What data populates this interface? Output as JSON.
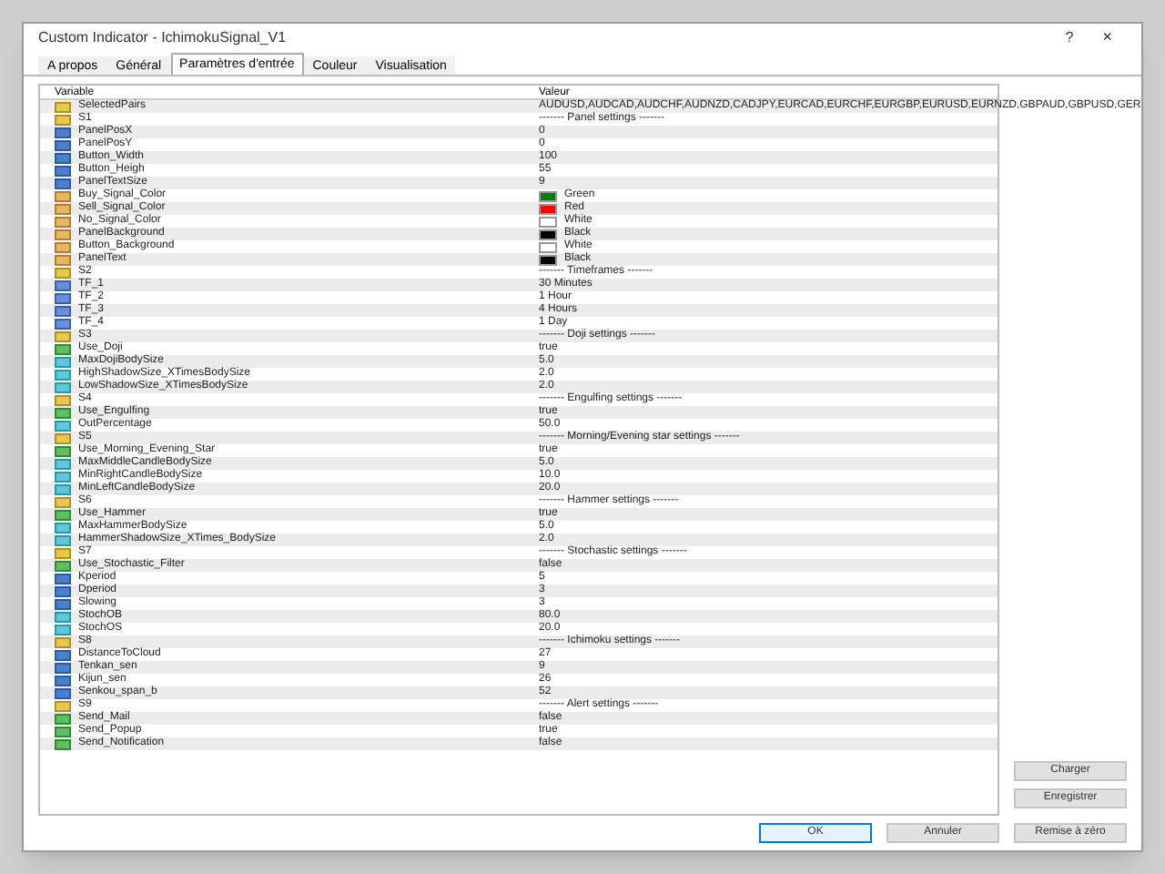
{
  "window": {
    "title": "Custom Indicator - IchimokuSignal_V1",
    "help": "?",
    "close": "×"
  },
  "tabs": [
    {
      "label": "A propos",
      "selected": false
    },
    {
      "label": "Général",
      "selected": false
    },
    {
      "label": "Paramètres d'entrée",
      "selected": true
    },
    {
      "label": "Couleur",
      "selected": false
    },
    {
      "label": "Visualisation",
      "selected": false
    }
  ],
  "table": {
    "columns": [
      "Variable",
      "Valeur"
    ],
    "rows": [
      {
        "name": "SelectedPairs",
        "value": "AUDUSD,AUDCAD,AUDCHF,AUDNZD,CADJPY,EURCAD,EURCHF,EURGBP,EURUSD,EURNZD,GBPAUD,GBPUSD,GER",
        "kind": "string"
      },
      {
        "name": "S1",
        "value": "------- Panel settings -------",
        "kind": "string"
      },
      {
        "name": "PanelPosX",
        "value": "0",
        "kind": "int"
      },
      {
        "name": "PanelPosY",
        "value": "0",
        "kind": "int"
      },
      {
        "name": "Button_Width",
        "value": "100",
        "kind": "int"
      },
      {
        "name": "Button_Heigh",
        "value": "55",
        "kind": "int"
      },
      {
        "name": "PanelTextSize",
        "value": "9",
        "kind": "int"
      },
      {
        "name": "Buy_Signal_Color",
        "value": "Green",
        "kind": "color",
        "color": "#008000"
      },
      {
        "name": "Sell_Signal_Color",
        "value": "Red",
        "kind": "color",
        "color": "#ff0000"
      },
      {
        "name": "No_Signal_Color",
        "value": "White",
        "kind": "color",
        "color": "#ffffff"
      },
      {
        "name": "PanelBackground",
        "value": "Black",
        "kind": "color",
        "color": "#000000"
      },
      {
        "name": "Button_Background",
        "value": "White",
        "kind": "color",
        "color": "#ffffff"
      },
      {
        "name": "PanelText",
        "value": "Black",
        "kind": "color",
        "color": "#000000"
      },
      {
        "name": "S2",
        "value": "------- Timeframes -------",
        "kind": "string"
      },
      {
        "name": "TF_1",
        "value": "30 Minutes",
        "kind": "enum"
      },
      {
        "name": "TF_2",
        "value": "1 Hour",
        "kind": "enum"
      },
      {
        "name": "TF_3",
        "value": "4 Hours",
        "kind": "enum"
      },
      {
        "name": "TF_4",
        "value": "1 Day",
        "kind": "enum"
      },
      {
        "name": "S3",
        "value": "------- Doji settings -------",
        "kind": "string"
      },
      {
        "name": "Use_Doji",
        "value": "true",
        "kind": "bool"
      },
      {
        "name": "MaxDojiBodySize",
        "value": "5.0",
        "kind": "double"
      },
      {
        "name": "HighShadowSize_XTimesBodySize",
        "value": "2.0",
        "kind": "double"
      },
      {
        "name": "LowShadowSize_XTimesBodySize",
        "value": "2.0",
        "kind": "double"
      },
      {
        "name": "S4",
        "value": "------- Engulfing settings -------",
        "kind": "string"
      },
      {
        "name": "Use_Engulfing",
        "value": "true",
        "kind": "bool"
      },
      {
        "name": "OutPercentage",
        "value": "50.0",
        "kind": "double"
      },
      {
        "name": "S5",
        "value": "------- Morning/Evening star settings -------",
        "kind": "string"
      },
      {
        "name": "Use_Morning_Evening_Star",
        "value": "true",
        "kind": "bool"
      },
      {
        "name": "MaxMiddleCandleBodySize",
        "value": "5.0",
        "kind": "double"
      },
      {
        "name": "MinRightCandleBodySize",
        "value": "10.0",
        "kind": "double"
      },
      {
        "name": "MinLeftCandleBodySize",
        "value": "20.0",
        "kind": "double"
      },
      {
        "name": "S6",
        "value": "------- Hammer settings -------",
        "kind": "string"
      },
      {
        "name": "Use_Hammer",
        "value": "true",
        "kind": "bool"
      },
      {
        "name": "MaxHammerBodySize",
        "value": "5.0",
        "kind": "double"
      },
      {
        "name": "HammerShadowSize_XTimes_BodySize",
        "value": "2.0",
        "kind": "double"
      },
      {
        "name": "S7",
        "value": "------- Stochastic settings -------",
        "kind": "string"
      },
      {
        "name": "Use_Stochastic_Filter",
        "value": "false",
        "kind": "bool"
      },
      {
        "name": "Kperiod",
        "value": "5",
        "kind": "int"
      },
      {
        "name": "Dperiod",
        "value": "3",
        "kind": "int"
      },
      {
        "name": "Slowing",
        "value": "3",
        "kind": "int"
      },
      {
        "name": "StochOB",
        "value": "80.0",
        "kind": "double"
      },
      {
        "name": "StochOS",
        "value": "20.0",
        "kind": "double"
      },
      {
        "name": "S8",
        "value": "------- Ichimoku settings -------",
        "kind": "string"
      },
      {
        "name": "DistanceToCloud",
        "value": "27",
        "kind": "int"
      },
      {
        "name": "Tenkan_sen",
        "value": "9",
        "kind": "int"
      },
      {
        "name": "Kijun_sen",
        "value": "26",
        "kind": "int"
      },
      {
        "name": "Senkou_span_b",
        "value": "52",
        "kind": "int"
      },
      {
        "name": "S9",
        "value": "------- Alert settings -------",
        "kind": "string"
      },
      {
        "name": "Send_Mail",
        "value": "false",
        "kind": "bool"
      },
      {
        "name": "Send_Popup",
        "value": "true",
        "kind": "bool"
      },
      {
        "name": "Send_Notification",
        "value": "false",
        "kind": "bool"
      }
    ]
  },
  "side_buttons": [
    "Charger",
    "Enregistrer"
  ],
  "buttons": [
    {
      "label": "OK",
      "focused": true
    },
    {
      "label": "Annuler",
      "focused": false
    },
    {
      "label": "Remise à zéro",
      "focused": false
    }
  ]
}
